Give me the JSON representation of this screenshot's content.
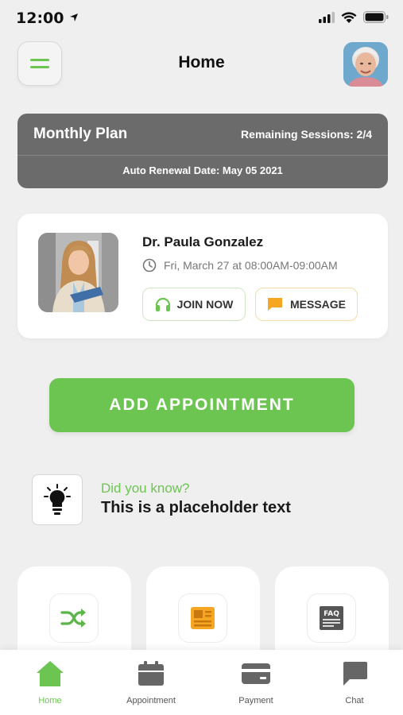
{
  "status_bar": {
    "time": "12:00"
  },
  "header": {
    "title": "Home"
  },
  "plan": {
    "title": "Monthly Plan",
    "remaining": "Remaining Sessions: 2/4",
    "renewal": "Auto Renewal Date: May 05 2021"
  },
  "appointment": {
    "doctor_name": "Dr. Paula Gonzalez",
    "time": "Fri, March 27 at 08:00AM-09:00AM",
    "join_label": "JOIN NOW",
    "message_label": "MESSAGE"
  },
  "add_appointment_label": "ADD APPOINTMENT",
  "tip": {
    "heading": "Did you know?",
    "text": "This is a placeholder text"
  },
  "features": [
    {
      "icon": "shuffle-icon"
    },
    {
      "icon": "newspaper-icon"
    },
    {
      "icon": "faq-icon"
    }
  ],
  "tabs": [
    {
      "label": "Home",
      "icon": "home-icon",
      "active": true
    },
    {
      "label": "Appointment",
      "icon": "calendar-icon",
      "active": false
    },
    {
      "label": "Payment",
      "icon": "card-icon",
      "active": false
    },
    {
      "label": "Chat",
      "icon": "chat-icon",
      "active": false
    }
  ],
  "colors": {
    "accent": "#6cc551",
    "plan_card": "#6b6b6b",
    "message_icon": "#f5a623",
    "background": "#efefef"
  }
}
